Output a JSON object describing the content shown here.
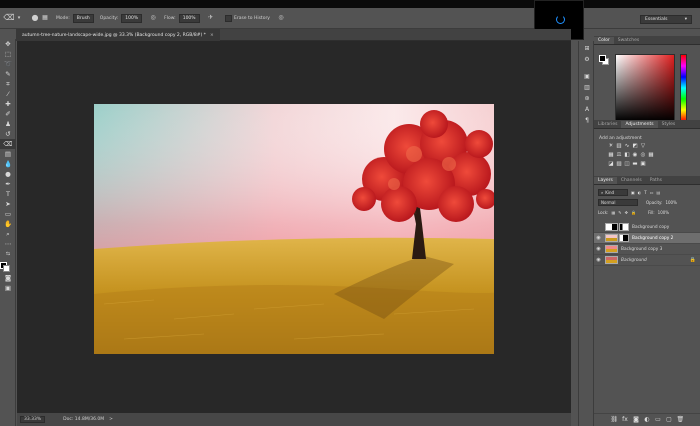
{
  "options_bar": {
    "mode_label": "Mode:",
    "mode_value": "Brush",
    "opacity_label": "Opacity:",
    "opacity_value": "100%",
    "flow_label": "Flow:",
    "flow_value": "100%",
    "erase_to_history": "Erase to History"
  },
  "workspace": {
    "label": "Essentials"
  },
  "document_tab": {
    "title": "autumn-tree-nature-landscape-wide.jpg @ 33.3% (Background copy 2, RGB/8#) *",
    "close": "×"
  },
  "status_bar": {
    "zoom": "33.33%",
    "doc_info": "Doc: 14.8M/36.0M",
    "arrow": ">"
  },
  "color_panel": {
    "tabs": [
      "Color",
      "Swatches"
    ],
    "foreground": "#000000",
    "background": "#ffffff"
  },
  "adjustments_panel": {
    "tabs": [
      "Libraries",
      "Adjustments",
      "Styles"
    ],
    "title": "Add an adjustment"
  },
  "layers_panel": {
    "tabs": [
      "Layers",
      "Channels",
      "Paths"
    ],
    "filter": "Kind",
    "blend_mode": "Normal",
    "opacity_label": "Opacity:",
    "opacity_value": "100%",
    "lock_label": "Lock:",
    "fill_label": "Fill:",
    "fill_value": "100%",
    "layers": [
      {
        "name": "Background copy",
        "visible": false,
        "selected": false,
        "has_mask": true
      },
      {
        "name": "Background copy 2",
        "visible": true,
        "selected": true,
        "has_mask": true
      },
      {
        "name": "Background copy 3",
        "visible": true,
        "selected": false,
        "has_mask": false
      },
      {
        "name": "Background",
        "visible": true,
        "selected": false,
        "has_mask": false
      }
    ]
  },
  "colors": {
    "panel_bg": "#535353",
    "canvas_bg": "#282828",
    "selected_layer": "#6e6e6e",
    "tree_red": "#d21e1e",
    "field_gold": "#c99a1c"
  }
}
